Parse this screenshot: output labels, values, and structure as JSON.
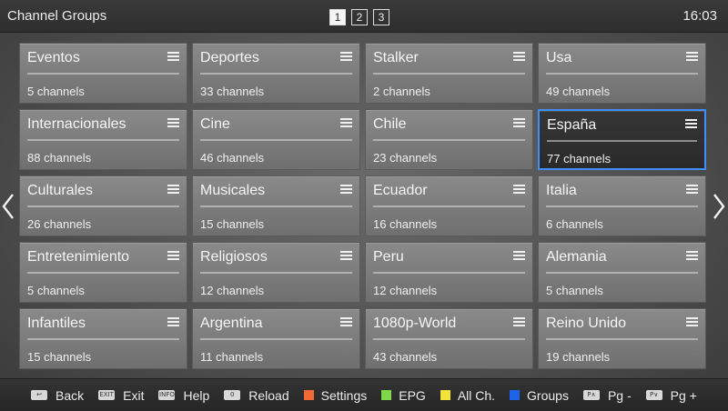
{
  "header": {
    "title": "Channel Groups",
    "clock": "16:03",
    "pages": [
      "1",
      "2",
      "3"
    ],
    "active_page": 0
  },
  "groups": [
    {
      "name": "Eventos",
      "count": "5 channels"
    },
    {
      "name": "Deportes",
      "count": "33 channels"
    },
    {
      "name": "Stalker",
      "count": "2 channels"
    },
    {
      "name": "Usa",
      "count": "49 channels"
    },
    {
      "name": "Internacionales",
      "count": "88 channels"
    },
    {
      "name": "Cine",
      "count": "46 channels"
    },
    {
      "name": "Chile",
      "count": "23 channels"
    },
    {
      "name": "España",
      "count": "77 channels"
    },
    {
      "name": "Culturales",
      "count": "26 channels"
    },
    {
      "name": "Musicales",
      "count": "15 channels"
    },
    {
      "name": "Ecuador",
      "count": "16 channels"
    },
    {
      "name": "Italia",
      "count": "6 channels"
    },
    {
      "name": "Entretenimiento",
      "count": "5 channels"
    },
    {
      "name": "Religiosos",
      "count": "12 channels"
    },
    {
      "name": "Peru",
      "count": "12 channels"
    },
    {
      "name": "Alemania",
      "count": "5 channels"
    },
    {
      "name": "Infantiles",
      "count": "15 channels"
    },
    {
      "name": "Argentina",
      "count": "11 channels"
    },
    {
      "name": "1080p-World",
      "count": "43 channels"
    },
    {
      "name": "Reino Unido",
      "count": "19 channels"
    }
  ],
  "selected_group": "España",
  "footer": {
    "hints": [
      {
        "kind": "key",
        "key": "↩",
        "label": "Back",
        "name": "back"
      },
      {
        "kind": "key",
        "key": "EXIT",
        "label": "Exit",
        "name": "exit"
      },
      {
        "kind": "key",
        "key": "INFO",
        "label": "Help",
        "name": "help"
      },
      {
        "kind": "key",
        "key": "0",
        "label": "Reload",
        "name": "reload"
      },
      {
        "kind": "color",
        "color": "#f06a3a",
        "label": "Settings",
        "name": "settings"
      },
      {
        "kind": "color",
        "color": "#7ed84a",
        "label": "EPG",
        "name": "epg"
      },
      {
        "kind": "color",
        "color": "#f2e23a",
        "label": "All Ch.",
        "name": "all-channels"
      },
      {
        "kind": "color",
        "color": "#1f63e8",
        "label": "Groups",
        "name": "groups"
      },
      {
        "kind": "key",
        "key": "P∧",
        "label": "Pg -",
        "name": "page-down"
      },
      {
        "kind": "key",
        "key": "P∨",
        "label": "Pg +",
        "name": "page-up"
      }
    ]
  },
  "icons": {
    "tile_menu": "list-icon",
    "prev": "chevron-left-icon",
    "next": "chevron-right-icon"
  },
  "colors": {
    "selection_border": "#3f8fff"
  }
}
